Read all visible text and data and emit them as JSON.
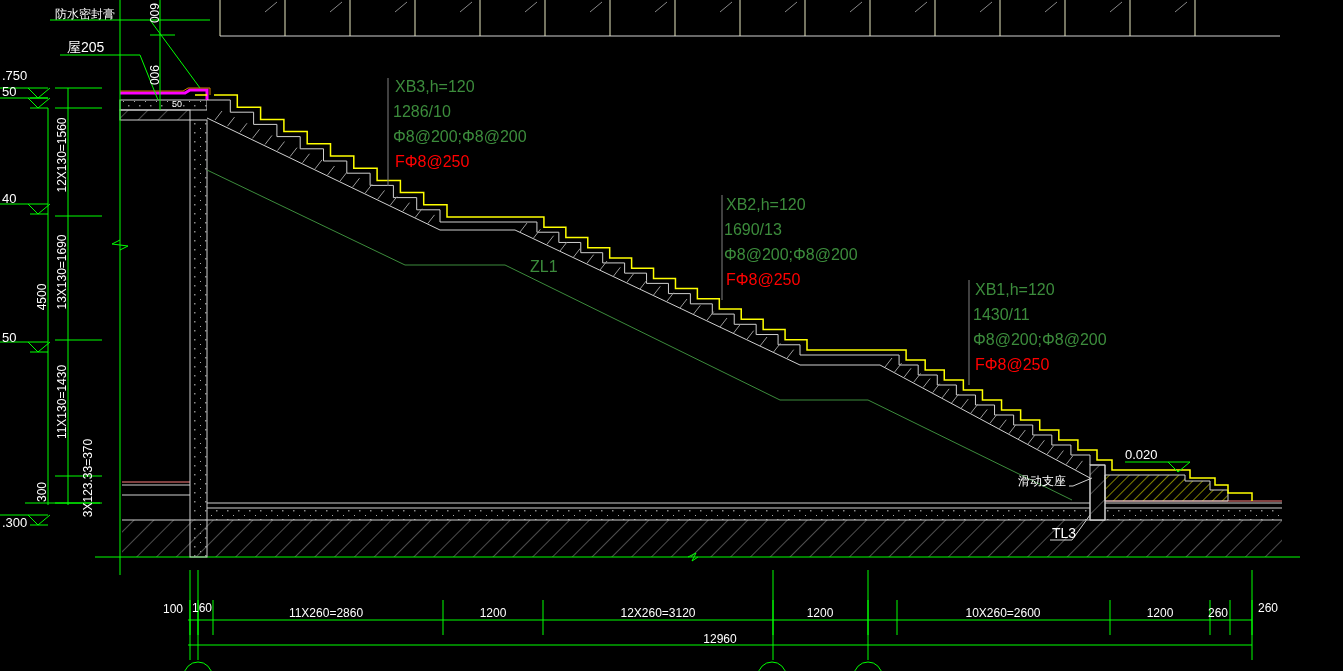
{
  "top_notes": [
    "防水密封膏",
    "屋205"
  ],
  "roof_dims": [
    "600",
    "900",
    "50"
  ],
  "left_levels": [
    ".750",
    "50",
    "40",
    "50",
    ".300"
  ],
  "height_dims": [
    "12X130=1560",
    "13X130=1690",
    "11X130=1430",
    "4500",
    "300",
    "3X123.33=370"
  ],
  "slab_notes": [
    {
      "name": "XB3,h=120",
      "span": "1286/10",
      "rebar": "Φ8@200;Φ8@200",
      "distribution_rebar": "FΦ8@250"
    },
    {
      "name": "XB2,h=120",
      "span": "1690/13",
      "rebar": "Φ8@200;Φ8@200",
      "distribution_rebar": "FΦ8@250"
    },
    {
      "name": "XB1,h=120",
      "span": "1430/11",
      "rebar": "Φ8@200;Φ8@200",
      "distribution_rebar": "FΦ8@250"
    }
  ],
  "beam_label": "ZL1",
  "support_label": "滑动支座",
  "column_label": "TL3",
  "floor_level": "0.020",
  "plan_dims": [
    "100",
    "160",
    "11X260=2860",
    "1200",
    "12X260=3120",
    "1200",
    "10X260=2600",
    "1200",
    "260",
    "260"
  ],
  "total_dim": "12960"
}
